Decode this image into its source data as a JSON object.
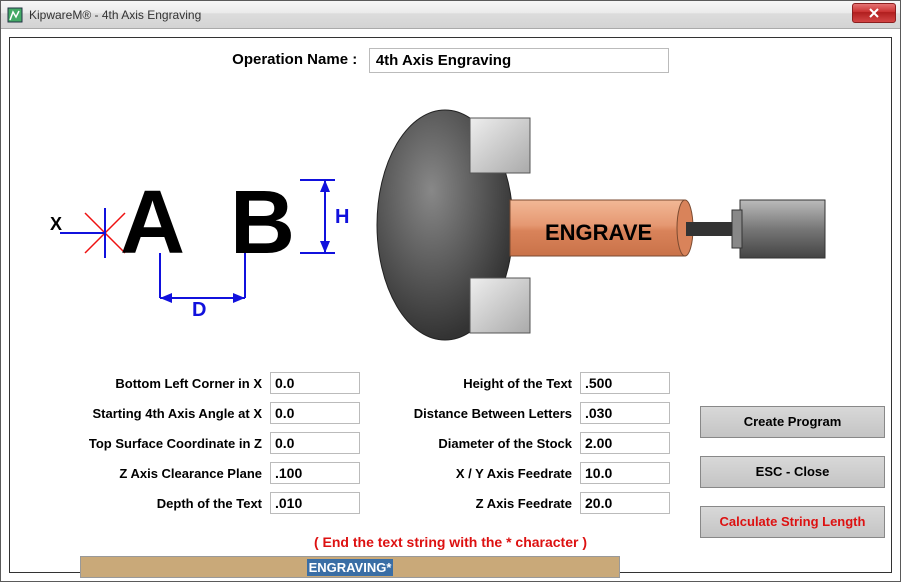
{
  "window": {
    "title": "KipwareM® - 4th Axis Engraving"
  },
  "op": {
    "label": "Operation Name :",
    "value": "4th Axis Engraving"
  },
  "diagram": {
    "letter_a": "A",
    "letter_b": "B",
    "x_label": "X",
    "d_label": "D",
    "h_label": "H",
    "engrave_text": "ENGRAVE"
  },
  "left_fields": [
    {
      "label": "Bottom Left Corner in X",
      "value": "0.0"
    },
    {
      "label": "Starting 4th Axis Angle at X",
      "value": "0.0"
    },
    {
      "label": "Top Surface Coordinate in Z",
      "value": "0.0"
    },
    {
      "label": "Z Axis Clearance Plane",
      "value": ".100"
    },
    {
      "label": "Depth of the Text",
      "value": ".010"
    }
  ],
  "right_fields": [
    {
      "label": "Height of the Text",
      "value": ".500"
    },
    {
      "label": "Distance Between Letters",
      "value": ".030"
    },
    {
      "label": "Diameter of the Stock",
      "value": "2.00"
    },
    {
      "label": "X / Y Axis Feedrate",
      "value": "10.0"
    },
    {
      "label": "Z Axis Feedrate",
      "value": "20.0"
    }
  ],
  "buttons": {
    "create": "Create Program",
    "close": "ESC - Close",
    "calc": "Calculate String Length"
  },
  "footer": {
    "hint": "( End the text string with the * character )",
    "string_value": "ENGRAVING*"
  }
}
